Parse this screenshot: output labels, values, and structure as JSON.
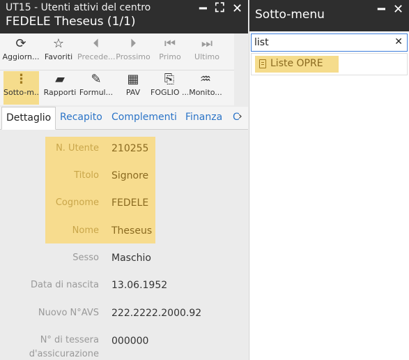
{
  "left_window": {
    "title_line1": "UT15 - Utenti attivi del centro",
    "title_line2": "FEDELE Theseus (1/1)",
    "controls": {
      "minimize": "━",
      "maximize": "⛶",
      "close": "✕"
    }
  },
  "toolbar_row1": [
    {
      "label": "Aggiorn...",
      "icon": "refresh-icon",
      "glyph": "⟳",
      "disabled": false
    },
    {
      "label": "Favoriti",
      "icon": "star-icon",
      "glyph": "☆",
      "disabled": false
    },
    {
      "label": "Precede...",
      "icon": "previous-icon",
      "glyph": "⏴",
      "disabled": true
    },
    {
      "label": "Prossimo",
      "icon": "next-icon",
      "glyph": "⏵",
      "disabled": true
    },
    {
      "label": "Primo",
      "icon": "first-icon",
      "glyph": "⏮",
      "disabled": true
    },
    {
      "label": "Ultimo",
      "icon": "last-icon",
      "glyph": "⏭",
      "disabled": true
    }
  ],
  "toolbar_row2": [
    {
      "label": "Sotto-m...",
      "icon": "vertical-dots-icon",
      "glyph": "⋮",
      "highlighted": true
    },
    {
      "label": "Rapporti",
      "icon": "folder-icon",
      "glyph": "▰"
    },
    {
      "label": "Formul...",
      "icon": "edit-icon",
      "glyph": "✎"
    },
    {
      "label": "PAV",
      "icon": "grid-icon",
      "glyph": "▦"
    },
    {
      "label": "FOGLIO ...",
      "icon": "document-icon",
      "glyph": "⎘"
    },
    {
      "label": "Monito...",
      "icon": "monitor-icon",
      "glyph": "♒"
    }
  ],
  "tabs": [
    "Dettaglio",
    "Recapito",
    "Complementi",
    "Finanza",
    "C"
  ],
  "tab_arrow": "›",
  "detail_fields": [
    {
      "label": "N. Utente",
      "value": "210255",
      "highlighted": true
    },
    {
      "label": "Titolo",
      "value": "Signore",
      "highlighted": true
    },
    {
      "label": "Cognome",
      "value": "FEDELE",
      "highlighted": true
    },
    {
      "label": "Nome",
      "value": "Theseus",
      "highlighted": true
    },
    {
      "label": "Sesso",
      "value": "Maschio",
      "highlighted": false
    },
    {
      "label": "Data di nascita",
      "value": "13.06.1952",
      "highlighted": false
    },
    {
      "label": "Nuovo N°AVS",
      "value": "222.2222.2000.92",
      "highlighted": false
    },
    {
      "label": "N° di tessera d'assicurazione",
      "value": "000000",
      "highlighted": false
    }
  ],
  "right_window": {
    "title": "Sotto-menu",
    "controls": {
      "minimize": "━",
      "close": "✕"
    },
    "search": {
      "value": "list",
      "clear": "✕"
    },
    "results": [
      "Liste OPRE"
    ]
  },
  "colors": {
    "titlebar": "#2e2e2e",
    "highlight": "#f5dc8c",
    "link": "#2b74c7",
    "search_border": "#3d7edb"
  }
}
